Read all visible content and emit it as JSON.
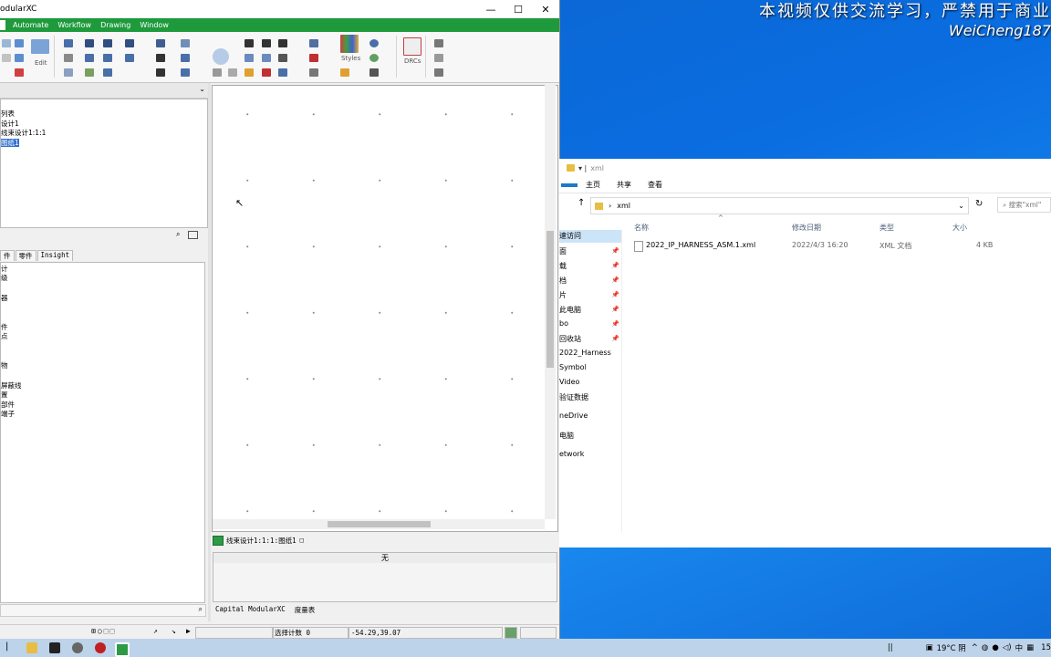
{
  "watermark": {
    "line1": "本视频仅供交流学习，严禁用于商业",
    "line2": "WeiCheng187"
  },
  "app": {
    "title": "odularXC",
    "menu": [
      "Automate",
      "Workflow",
      "Drawing",
      "Window"
    ],
    "ribbon_labels": {
      "edit": "Edit",
      "styles": "Styles",
      "drcs": "DRCs"
    },
    "tree_items": [
      "列表",
      "设计1",
      "线束设计1:1:1",
      "图纸1"
    ],
    "tabs": [
      "件",
      "零件",
      "Insight"
    ],
    "list_items": [
      "计",
      "级",
      "器",
      "件",
      "点",
      "物",
      "屏蔽线",
      "置",
      "部件",
      "端子"
    ],
    "doc_tab": "线束设计1:1:1:图纸1",
    "output_header": "无",
    "output_tabs": [
      "Capital ModularXC",
      "度量表"
    ],
    "status": {
      "select_count": "选择计数 0",
      "coords": "-54.29,39.07"
    }
  },
  "explorer": {
    "title": "xml",
    "ribbon_tabs": [
      "主页",
      "共享",
      "查看"
    ],
    "address": "xml",
    "search_placeholder": "搜索\"xml\"",
    "nav": [
      "速访问",
      "面",
      "载",
      "档",
      "片",
      "此电脑",
      "bo",
      "回收站",
      "2022_Harness",
      "Symbol",
      "Video",
      "验证数据",
      "neDrive",
      "电脑",
      "etwork"
    ],
    "columns": {
      "name": "名称",
      "date": "修改日期",
      "type": "类型",
      "size": "大小"
    },
    "files": [
      {
        "name": "2022_IP_HARNESS_ASM.1.xml",
        "date": "2022/4/3 16:20",
        "type": "XML 文档",
        "size": "4 KB"
      }
    ]
  },
  "taskbar": {
    "weather": "19°C 阴",
    "ime": "中",
    "clock": "15"
  }
}
